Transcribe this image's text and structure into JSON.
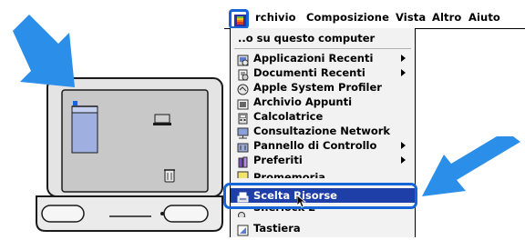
{
  "menubar": {
    "items": [
      {
        "label": "rchivio"
      },
      {
        "label": "Composizione"
      },
      {
        "label": "Vista"
      },
      {
        "label": "Altro"
      },
      {
        "label": "Aiuto"
      }
    ]
  },
  "menu": {
    "header": "..o su questo computer",
    "items": [
      {
        "label": "Applicazioni Recenti",
        "icon": "recent-apps-icon",
        "submenu": true
      },
      {
        "label": "Documenti Recenti",
        "icon": "recent-docs-icon",
        "submenu": true
      },
      {
        "label": "Apple System Profiler",
        "icon": "system-profiler-icon",
        "submenu": false
      },
      {
        "label": "Archivio Appunti",
        "icon": "clipboard-icon",
        "submenu": false
      },
      {
        "label": "Calcolatrice",
        "icon": "calculator-icon",
        "submenu": false
      },
      {
        "label": "Consultazione Network",
        "icon": "network-browser-icon",
        "submenu": false
      },
      {
        "label": "Pannello di Controllo",
        "icon": "control-panel-icon",
        "submenu": true
      },
      {
        "label": "Preferiti",
        "icon": "favorites-icon",
        "submenu": true
      },
      {
        "label": "Promemoria",
        "icon": "stickies-icon",
        "submenu": false
      },
      {
        "label": "Scelta Risorse",
        "icon": "chooser-icon",
        "submenu": false,
        "selected": true
      },
      {
        "label": "Sherlock 2",
        "icon": "sherlock-icon",
        "submenu": false
      },
      {
        "label": "Tastiera",
        "icon": "keyboard-icon",
        "submenu": false
      }
    ]
  },
  "colors": {
    "highlight": "#1565d8",
    "selection": "#1e3ea8",
    "arrow": "#2b8ee8",
    "screen": "#c8c8c8"
  }
}
